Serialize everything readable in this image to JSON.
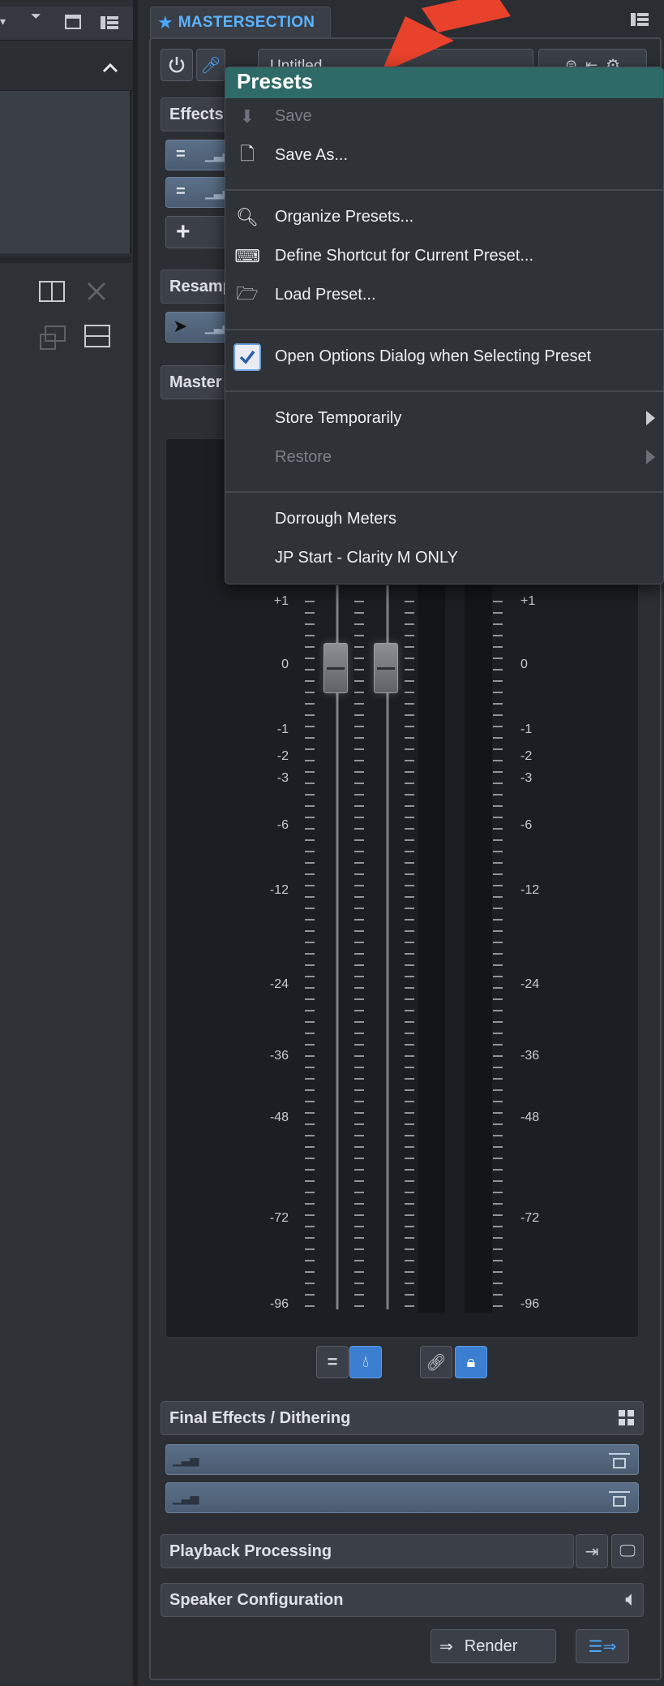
{
  "mastersection": {
    "tab_title": "MASTERSECTION",
    "preset_field_value": "Untitled"
  },
  "sections": {
    "effects": "Effects",
    "resampling": "Resamp",
    "master": "Master",
    "final_effects": "Final Effects / Dithering",
    "playback": "Playback Processing",
    "speakers": "Speaker Configuration"
  },
  "meter": {
    "left_labels": [
      "+1",
      "0",
      "-1",
      "-2",
      "-3",
      "-6",
      "-12",
      "-24",
      "-36",
      "-48",
      "-72",
      "-96"
    ],
    "right_labels": [
      "+1",
      "0",
      "-1",
      "-2",
      "-3",
      "-6",
      "-12",
      "-24",
      "-36",
      "-48",
      "-72",
      "-96"
    ]
  },
  "menu": {
    "title": "Presets",
    "items": {
      "save": "Save",
      "save_as": "Save As...",
      "organize": "Organize Presets...",
      "define_shortcut": "Define Shortcut for Current Preset...",
      "load": "Load Preset...",
      "open_options": "Open Options Dialog when Selecting Preset",
      "store_temp": "Store Temporarily",
      "restore": "Restore",
      "dorrough": "Dorrough Meters",
      "jp_start": "JP Start - Clarity M ONLY"
    }
  },
  "render": {
    "label": "Render"
  },
  "colors": {
    "accent_blue": "#4aa8ff",
    "menu_title_bg": "#2e6a68",
    "arrow_red": "#e8412c"
  }
}
